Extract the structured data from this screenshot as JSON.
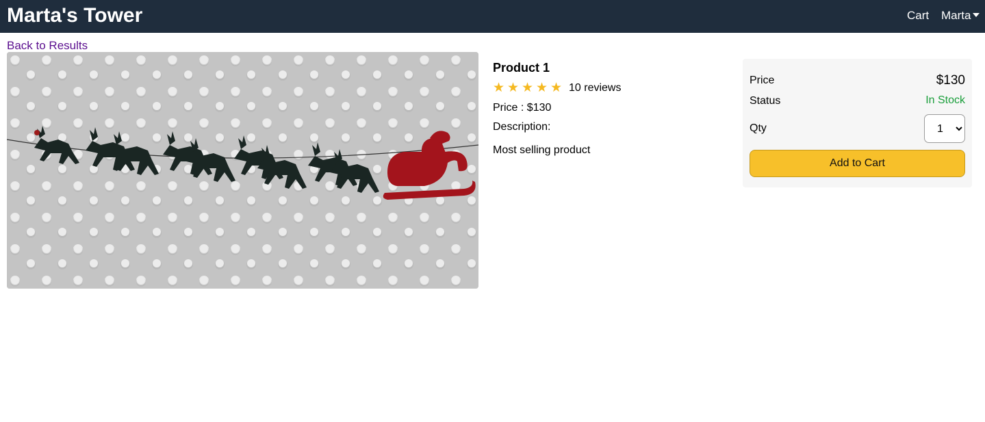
{
  "header": {
    "brand": "Marta's Tower",
    "cart_label": "Cart",
    "user_name": "Marta"
  },
  "back_link": "Back to Results",
  "product": {
    "name": "Product 1",
    "rating": 5,
    "reviews": "10 reviews",
    "price_line": "Price : $130",
    "description_label": "Description:",
    "description": "Most selling product",
    "image_alt": "reindeer-and-sleigh-garland"
  },
  "purchase": {
    "price_label": "Price",
    "price_value": "$130",
    "status_label": "Status",
    "status_value": "In Stock",
    "qty_label": "Qty",
    "qty_selected": "1",
    "qty_options": [
      "1"
    ],
    "add_to_cart": "Add to Cart"
  },
  "colors": {
    "header_bg": "#1f2d3d",
    "star": "#f5b921",
    "in_stock": "#1a9e3b",
    "cta": "#f7c02a",
    "link": "#5b0f8f"
  }
}
